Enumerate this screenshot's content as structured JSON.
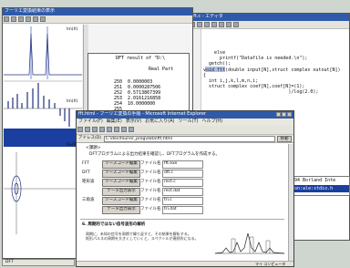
{
  "plot_window": {
    "title": "フーリエ変換結果の表示",
    "labels": {
      "top": "Im(X)",
      "mid": "Im(X)",
      "bottom": "Re(X)"
    }
  },
  "output_window": {
    "title": "DFT result of \"D:\\",
    "header": "Real Part",
    "rows": [
      {
        "i": "250",
        "v": "0.0000003"
      },
      {
        "i": "251",
        "v": "0.0000287506"
      },
      {
        "i": "252",
        "v": "0.5713867399"
      },
      {
        "i": "253",
        "v": "2.0161216858"
      },
      {
        "i": "254",
        "v": "10.0000000"
      },
      {
        "i": "255",
        "v": ""
      }
    ]
  },
  "editor_window": {
    "title": "dft.c - エディタ",
    "code": [
      "    else",
      "      printf(\"Datafile is needed.\\n\");",
      "",
      "  getch();",
      "",
      "void ftt(double input[N],struct complex outout[N])",
      "{",
      "  int i,j,k,l,m,n,i;",
      "  struct complex coef[N],coef[N]=(1);",
      "",
      "",
      "",
      "                               )/log(2.0);"
    ]
  },
  "compiler_window": {
    "line1": "1994 Borland Inte",
    "line2": "tion:ale:stdio.h"
  },
  "browser": {
    "title": "fft.html - フーリエ変換の手順 - Microsoft Internet Explorer",
    "menu": [
      "ファイル(F)",
      "編集(E)",
      "表示(V)",
      "お気に入り(A)",
      "ツール(T)",
      "ヘルプ(H)"
    ],
    "address_label": "アドレス(D)",
    "address": "C:\\dev\\fourier_prog\\data\\fft.html",
    "go": "移動",
    "heading": "<課題>",
    "desc": "DFTプログラムによる出力結果を確認し、DFTプログラムを作成する。",
    "rows": [
      {
        "prefix": "FFT",
        "button": "ソースコード編集",
        "file_label": "ファイル名",
        "file": "fft.exe"
      },
      {
        "prefix": "DFT",
        "button": "ソースコード編集",
        "file_label": "ファイル名",
        "file": "dft.c"
      },
      {
        "prefix": "矩形波",
        "button": "ソースコード編集",
        "file_label": "ファイル名",
        "file": "rect.c"
      },
      {
        "prefix": "",
        "button": "データ出力表示",
        "file_label": "ファイル名",
        "file": "rect.dat"
      },
      {
        "prefix": "三角波",
        "button": "ソースコード編集",
        "file_label": "ファイル名",
        "file": "tri.c"
      },
      {
        "prefix": "",
        "button": "データ出力表示",
        "file_label": "ファイル名",
        "file": "tri.dat"
      }
    ],
    "section": "6. 周期的ではない信号波形の解析",
    "section_text": "周期に、未知の信号を周期で繰り返すと、その結果を解析する。\n矩形パルスの周期を大きくしていくと、スペクトルが連続的になる。",
    "status": "マイ コンピュータ"
  },
  "taskbar": {
    "item": "DFT"
  }
}
